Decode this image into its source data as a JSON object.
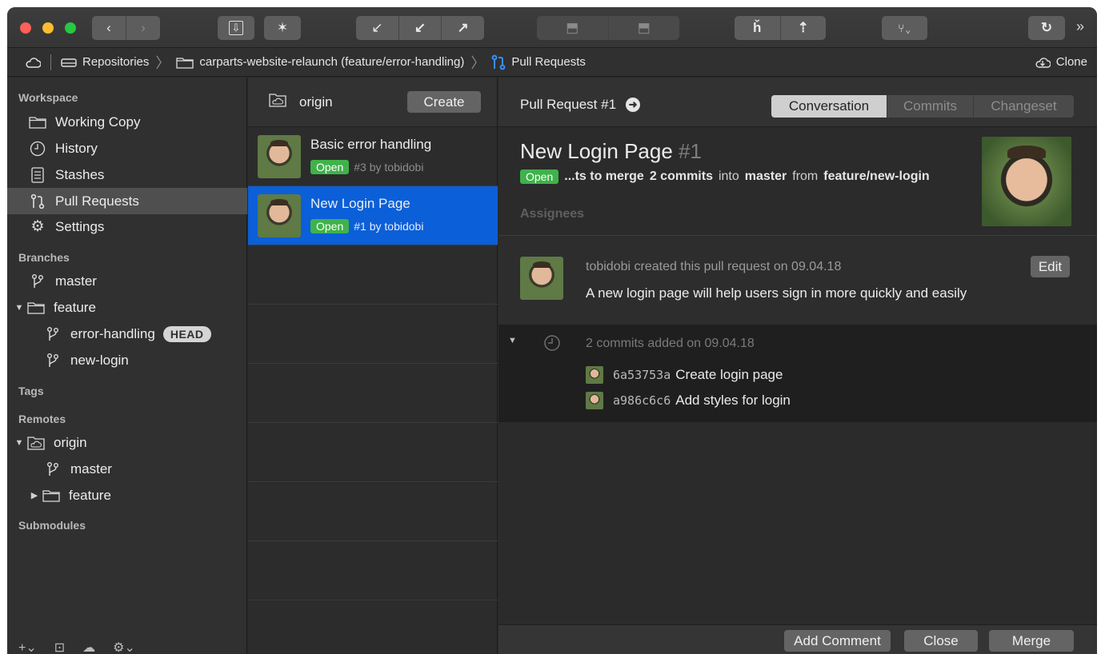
{
  "toolbar": {
    "traffic_colors": [
      "#fe5f57",
      "#febc2e",
      "#28c840"
    ],
    "icons": [
      "back-icon",
      "forward-icon",
      "stash-icon",
      "magic-wand-icon",
      "fetch-icon",
      "pull-icon",
      "push-icon",
      "merge-icon",
      "rebase-icon",
      "branch-icon",
      "tag-icon",
      "compare-icon",
      "refresh-icon"
    ],
    "overflow": "»"
  },
  "breadcrumb": {
    "repositories": "Repositories",
    "repo": "carparts-website-relaunch (feature/error-handling)",
    "section": "Pull Requests",
    "clone": "Clone"
  },
  "sidebar": {
    "workspace_label": "Workspace",
    "workspace": [
      {
        "label": "Working Copy"
      },
      {
        "label": "History"
      },
      {
        "label": "Stashes"
      },
      {
        "label": "Pull Requests"
      },
      {
        "label": "Settings"
      }
    ],
    "branches_label": "Branches",
    "branches": {
      "master": "master",
      "feature": "feature",
      "error_handling": "error-handling",
      "head_badge": "HEAD",
      "new_login": "new-login"
    },
    "tags_label": "Tags",
    "remotes_label": "Remotes",
    "remotes": {
      "origin": "origin",
      "master": "master",
      "feature": "feature"
    },
    "submodules_label": "Submodules",
    "footer_icons": [
      "add-icon",
      "view-icon",
      "remote-icon",
      "gear-icon"
    ]
  },
  "pr_list": {
    "remote": "origin",
    "create_label": "Create",
    "items": [
      {
        "title": "Basic error handling",
        "status": "Open",
        "meta": "#3 by tobidobi"
      },
      {
        "title": "New Login Page",
        "status": "Open",
        "meta": "#1 by tobidobi"
      }
    ]
  },
  "detail": {
    "header_title": "Pull Request #1",
    "tabs": [
      "Conversation",
      "Commits",
      "Changeset"
    ],
    "active_tab": "Conversation",
    "title": "New Login Page",
    "number": "#1",
    "status": "Open",
    "desc_prefix": "...ts to merge",
    "desc_commits": "2 commits",
    "desc_into": "into",
    "desc_target": "master",
    "desc_from": "from",
    "desc_source": "feature/new-login",
    "assignees_label": "Assignees",
    "comment_meta": "tobidobi created this pull request on 09.04.18",
    "comment_body": "A new login page will help users sign in more quickly and easily",
    "edit_label": "Edit",
    "commits_header": "2 commits added on 09.04.18",
    "commits": [
      {
        "sha": "6a53753a",
        "message": "Create login page"
      },
      {
        "sha": "a986c6c6",
        "message": "Add styles for login"
      }
    ],
    "buttons": {
      "add_comment": "Add Comment",
      "close": "Close",
      "merge": "Merge"
    }
  },
  "colors": {
    "selection_blue": "#0b5fd8",
    "open_green": "#3fb24a"
  }
}
